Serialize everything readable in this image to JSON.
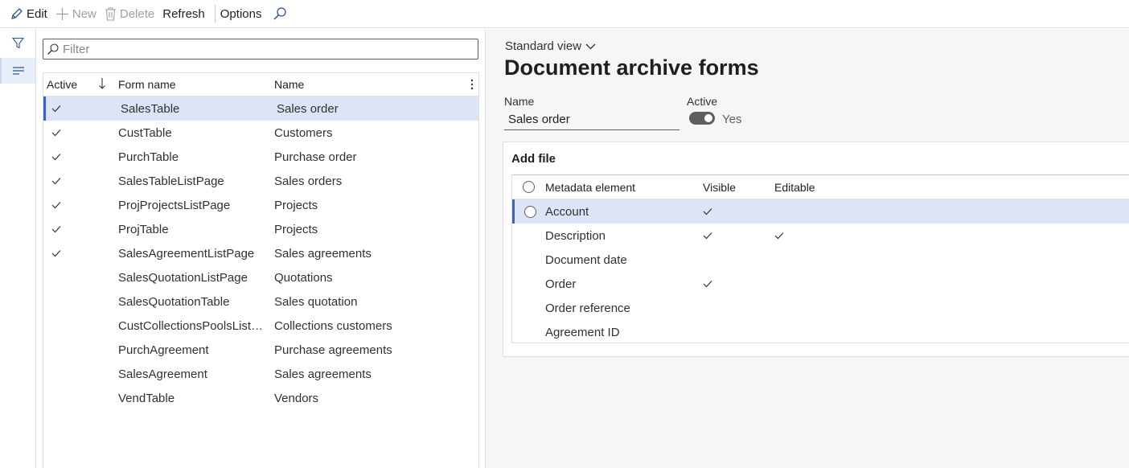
{
  "actions": {
    "edit": "Edit",
    "new": "New",
    "delete": "Delete",
    "refresh": "Refresh",
    "options": "Options"
  },
  "filter": {
    "placeholder": "Filter"
  },
  "list": {
    "columns": {
      "active": "Active",
      "form_name": "Form name",
      "name": "Name"
    },
    "rows": [
      {
        "active": true,
        "form_name": "SalesTable",
        "name": "Sales order"
      },
      {
        "active": true,
        "form_name": "CustTable",
        "name": "Customers"
      },
      {
        "active": true,
        "form_name": "PurchTable",
        "name": "Purchase order"
      },
      {
        "active": true,
        "form_name": "SalesTableListPage",
        "name": "Sales orders"
      },
      {
        "active": true,
        "form_name": "ProjProjectsListPage",
        "name": "Projects"
      },
      {
        "active": true,
        "form_name": "ProjTable",
        "name": "Projects"
      },
      {
        "active": true,
        "form_name": "SalesAgreementListPage",
        "name": "Sales agreements"
      },
      {
        "active": false,
        "form_name": "SalesQuotationListPage",
        "name": "Quotations"
      },
      {
        "active": false,
        "form_name": "SalesQuotationTable",
        "name": "Sales quotation"
      },
      {
        "active": false,
        "form_name": "CustCollectionsPoolsListPage",
        "name": "Collections customers"
      },
      {
        "active": false,
        "form_name": "PurchAgreement",
        "name": "Purchase agreements"
      },
      {
        "active": false,
        "form_name": "SalesAgreement",
        "name": "Sales agreements"
      },
      {
        "active": false,
        "form_name": "VendTable",
        "name": "Vendors"
      }
    ]
  },
  "detail": {
    "view_selector": "Standard view",
    "title": "Document archive forms",
    "name_label": "Name",
    "name_value": "Sales order",
    "active_label": "Active",
    "active_value": "Yes",
    "fasttab_title": "Add file",
    "subgrid": {
      "columns": {
        "meta": "Metadata element",
        "visible": "Visible",
        "editable": "Editable"
      },
      "rows": [
        {
          "meta": "Account",
          "visible": true,
          "editable": false
        },
        {
          "meta": "Description",
          "visible": true,
          "editable": true
        },
        {
          "meta": "Document date",
          "visible": false,
          "editable": false
        },
        {
          "meta": "Order",
          "visible": true,
          "editable": false
        },
        {
          "meta": "Order reference",
          "visible": false,
          "editable": false
        },
        {
          "meta": "Agreement ID",
          "visible": false,
          "editable": false
        }
      ]
    }
  },
  "colors": {
    "accent": "#3a62c6",
    "selected_row": "#dce5f7"
  }
}
